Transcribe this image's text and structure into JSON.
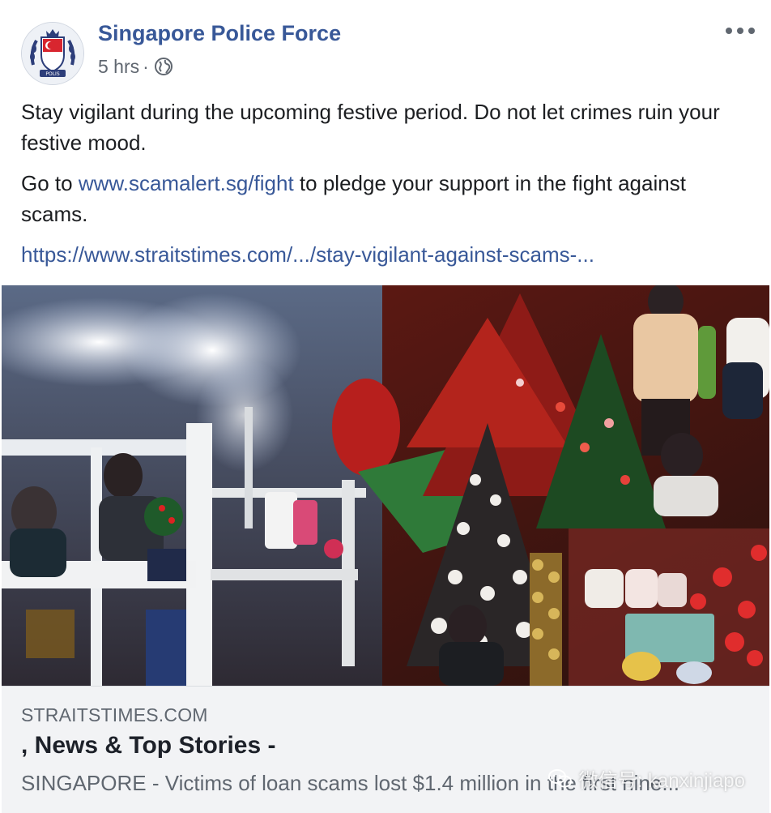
{
  "post": {
    "page_name": "Singapore Police Force",
    "time": "5 hrs",
    "separator": "·",
    "audience_icon": "globe-icon",
    "more_icon": "more-options-icon",
    "avatar_text": "POLIS",
    "text": {
      "p1": "Stay vigilant during the upcoming festive period. Do not let crimes ruin your festive mood.",
      "p2_before": "Go to ",
      "p2_link": "www.scamalert.sg/fight",
      "p2_after": " to pledge your support in the fight against scams.",
      "p3_link": "https://www.straitstimes.com/.../stay-vigilant-against-scams-..."
    }
  },
  "preview": {
    "domain": "STRAITSTIMES.COM",
    "title": ", News & Top Stories -",
    "description": "SINGAPORE - Victims of loan scams lost $1.4 million in the first nine..."
  },
  "watermark": {
    "icon": "wechat-icon",
    "text": "微信号: kanxinjiapo"
  },
  "colors": {
    "link": "#385898",
    "text": "#1c1e21",
    "meta": "#606770",
    "preview_bg": "#f2f3f5"
  }
}
